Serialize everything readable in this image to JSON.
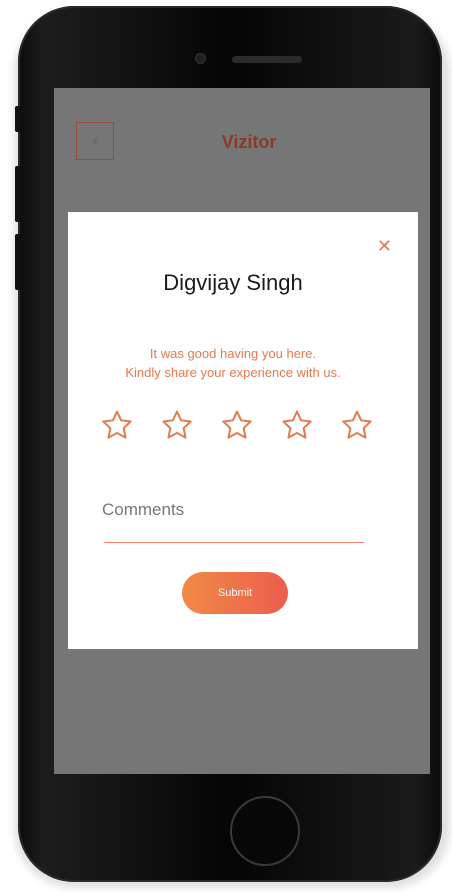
{
  "app": {
    "title": "Vizitor",
    "back_icon": "chevron-left-icon"
  },
  "feedback_modal": {
    "close_icon": "close-icon",
    "visitor_name": "Digvijay Singh",
    "message_line1": "It was good having you here.",
    "message_line2": "Kindly share your experience with us.",
    "rating": {
      "max": 5,
      "selected": 0,
      "star_icon": "star-outline-icon"
    },
    "comments_placeholder": "Comments",
    "submit_label": "Submit"
  },
  "colors": {
    "accent": "#e37a4c",
    "gradient_start": "#f08a45",
    "gradient_end": "#ec5d4f",
    "overlay": "#767676"
  }
}
